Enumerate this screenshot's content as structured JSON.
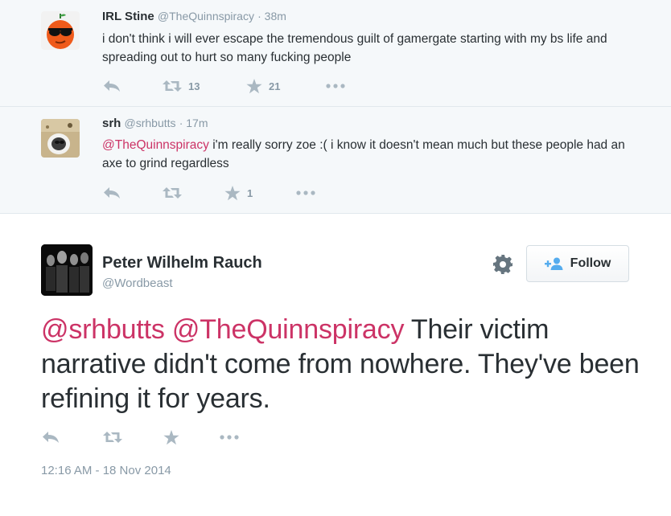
{
  "tweets": [
    {
      "name": "IRL Stine",
      "handle": "@TheQuinnspiracy",
      "time": "· 38m",
      "text": "i don't think i will ever escape the tremendous guilt of gamergate starting with my bs life and spreading out to hurt so many fucking people",
      "retweets": "13",
      "favorites": "21"
    },
    {
      "name": "srh",
      "handle": "@srhbutts",
      "time": "· 17m",
      "mention": "@TheQuinnspiracy",
      "text": " i'm really sorry zoe :( i know it doesn't mean much but these people had an axe to grind regardless",
      "retweets": "",
      "favorites": "1"
    }
  ],
  "main": {
    "name": "Peter Wilhelm Rauch",
    "handle": "@Wordbeast",
    "follow_label": "Follow",
    "mention1": "@srhbutts",
    "mention2": "@TheQuinnspiracy",
    "text": " Their victim narrative didn't come from nowhere. They've been refining it for years.",
    "timestamp": "12:16 AM - 18 Nov 2014"
  },
  "colors": {
    "mention": "#cc3366",
    "muted": "#8899a6",
    "icon": "#aab8c2",
    "context_bg": "#f5f8fa"
  },
  "icons": [
    "reply-icon",
    "retweet-icon",
    "favorite-icon",
    "more-icon",
    "gear-icon",
    "follow-user-icon"
  ]
}
